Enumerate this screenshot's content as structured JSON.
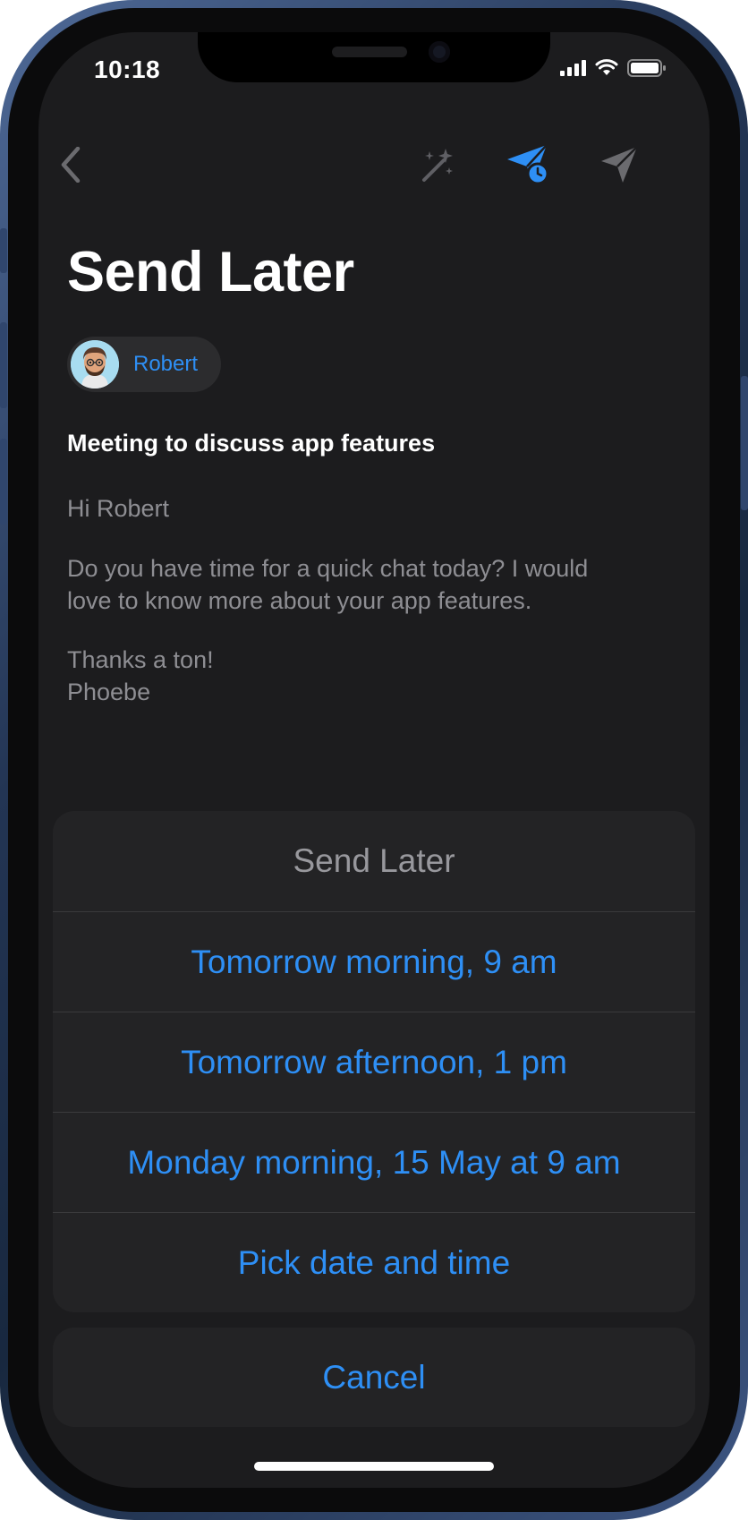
{
  "status_bar": {
    "time": "10:18"
  },
  "toolbar": {
    "back_icon": "chevron-left-icon",
    "magic_icon": "sparkles-icon",
    "schedule_icon": "paperplane-clock-icon",
    "send_icon": "paperplane-icon",
    "accent_color": "#2e8ff5"
  },
  "compose": {
    "title": "Send Later",
    "recipient": {
      "name": "Robert",
      "avatar": "memoji-avatar"
    },
    "subject": "Meeting to discuss app features",
    "greeting": "Hi Robert",
    "body_line1": "Do you have time for a quick chat today? I would",
    "body_line2": "love to know more about your app features.",
    "signoff": "Thanks a ton!",
    "signature": "Phoebe"
  },
  "action_sheet": {
    "title": "Send Later",
    "options": [
      "Tomorrow morning, 9 am",
      "Tomorrow afternoon, 1 pm",
      "Monday morning, 15 May at 9 am",
      "Pick date and time"
    ],
    "cancel": "Cancel"
  }
}
